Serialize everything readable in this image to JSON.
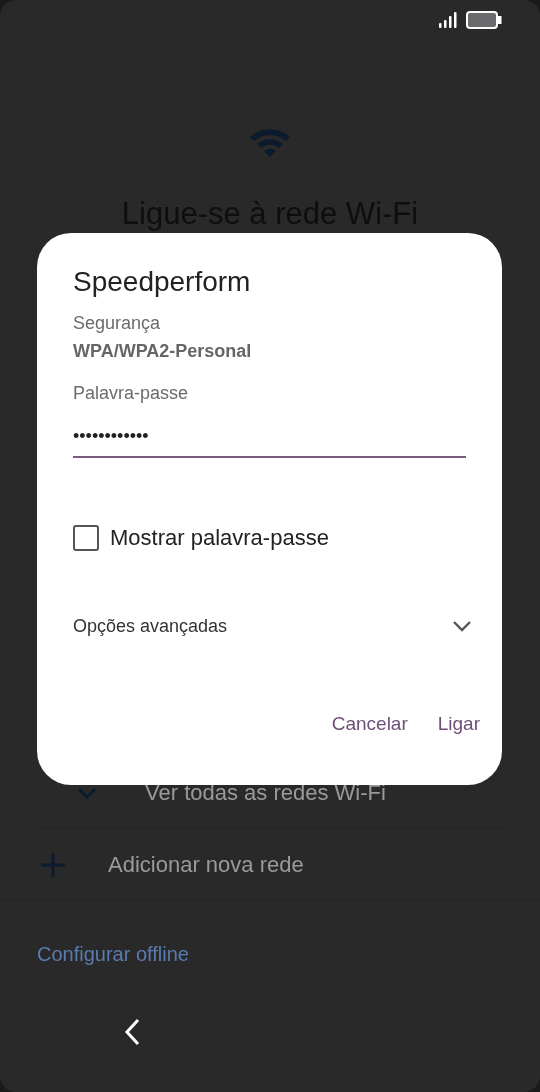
{
  "background": {
    "title": "Ligue-se à rede Wi-Fi",
    "rows": [
      {
        "kind": "expand",
        "label": "Ver todas as redes Wi-Fi"
      },
      {
        "kind": "add",
        "label": "Adicionar nova rede"
      }
    ],
    "offline_link": "Configurar offline"
  },
  "dialog": {
    "title": "Speedperform",
    "security_label": "Segurança",
    "security_value": "WPA/WPA2-Personal",
    "password_label": "Palavra-passe",
    "password_value": "••••••••••••",
    "show_password": {
      "label": "Mostrar palavra-passe",
      "checked": false
    },
    "advanced_options": {
      "label": "Opções avançadas",
      "expanded": false
    },
    "buttons": [
      "Cancelar",
      "Ligar"
    ]
  }
}
